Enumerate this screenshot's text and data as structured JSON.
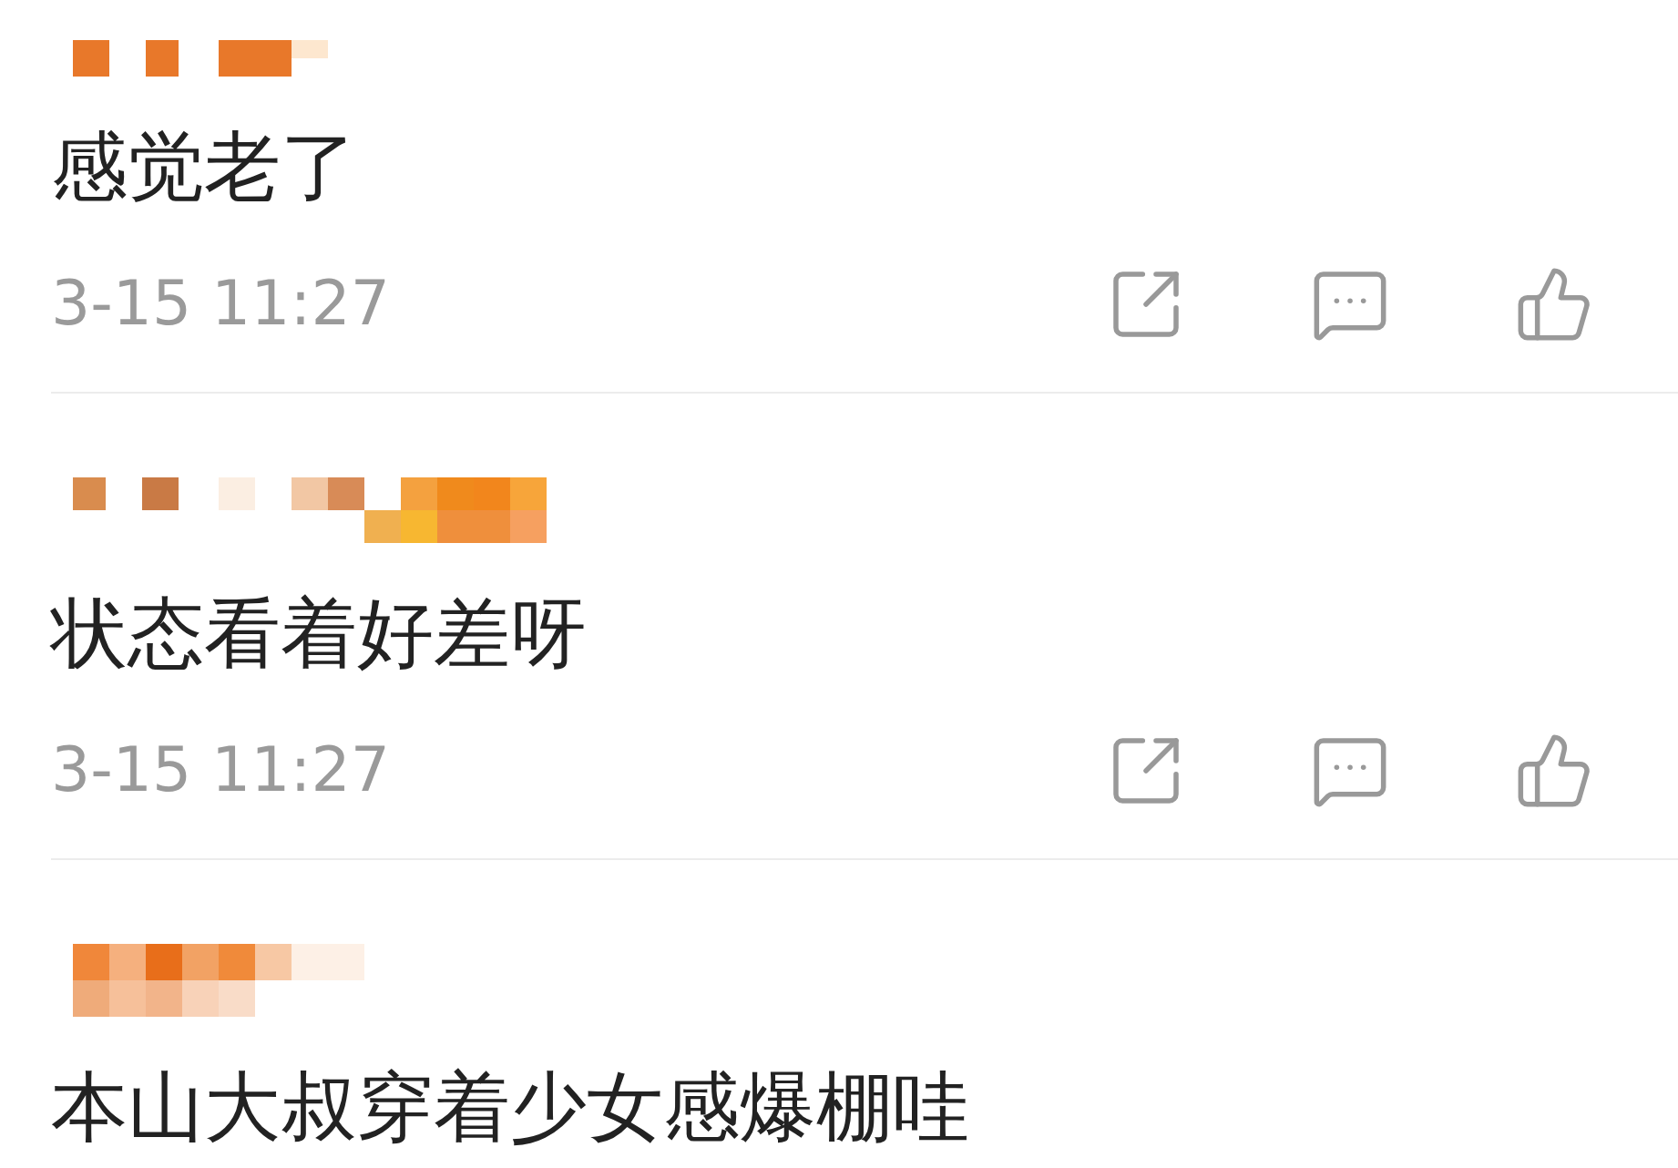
{
  "comments": [
    {
      "text": "感觉老了",
      "time": "3-15 11:27"
    },
    {
      "text": "状态看着好差呀",
      "time": "3-15 11:27"
    },
    {
      "text": "本山大叔穿着少女感爆棚哇"
    }
  ]
}
